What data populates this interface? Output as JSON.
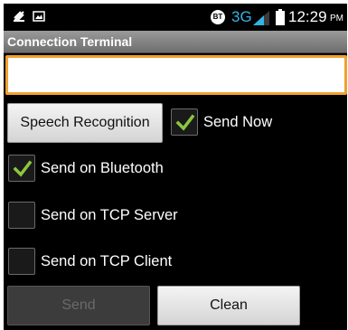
{
  "status_bar": {
    "network_type": "3G",
    "bt_badge": "BT",
    "time": "12:29",
    "ampm": "PM",
    "icons": [
      "usb-icon",
      "image-icon",
      "bt-icon",
      "signal-icon",
      "battery-icon"
    ]
  },
  "app": {
    "title": "Connection Terminal",
    "input": {
      "value": "",
      "placeholder": ""
    },
    "speech_button": "Speech Recognition",
    "checkboxes": [
      {
        "label": "Send Now",
        "checked": true
      },
      {
        "label": "Send on Bluetooth",
        "checked": true
      },
      {
        "label": "Send on TCP Server",
        "checked": false
      },
      {
        "label": "Send on TCP Client",
        "checked": false
      }
    ],
    "send_button": "Send",
    "send_enabled": false,
    "clean_button": "Clean"
  },
  "colors": {
    "check": "#8cc63f",
    "input_border": "#f0a030",
    "network": "#33b5e5"
  }
}
